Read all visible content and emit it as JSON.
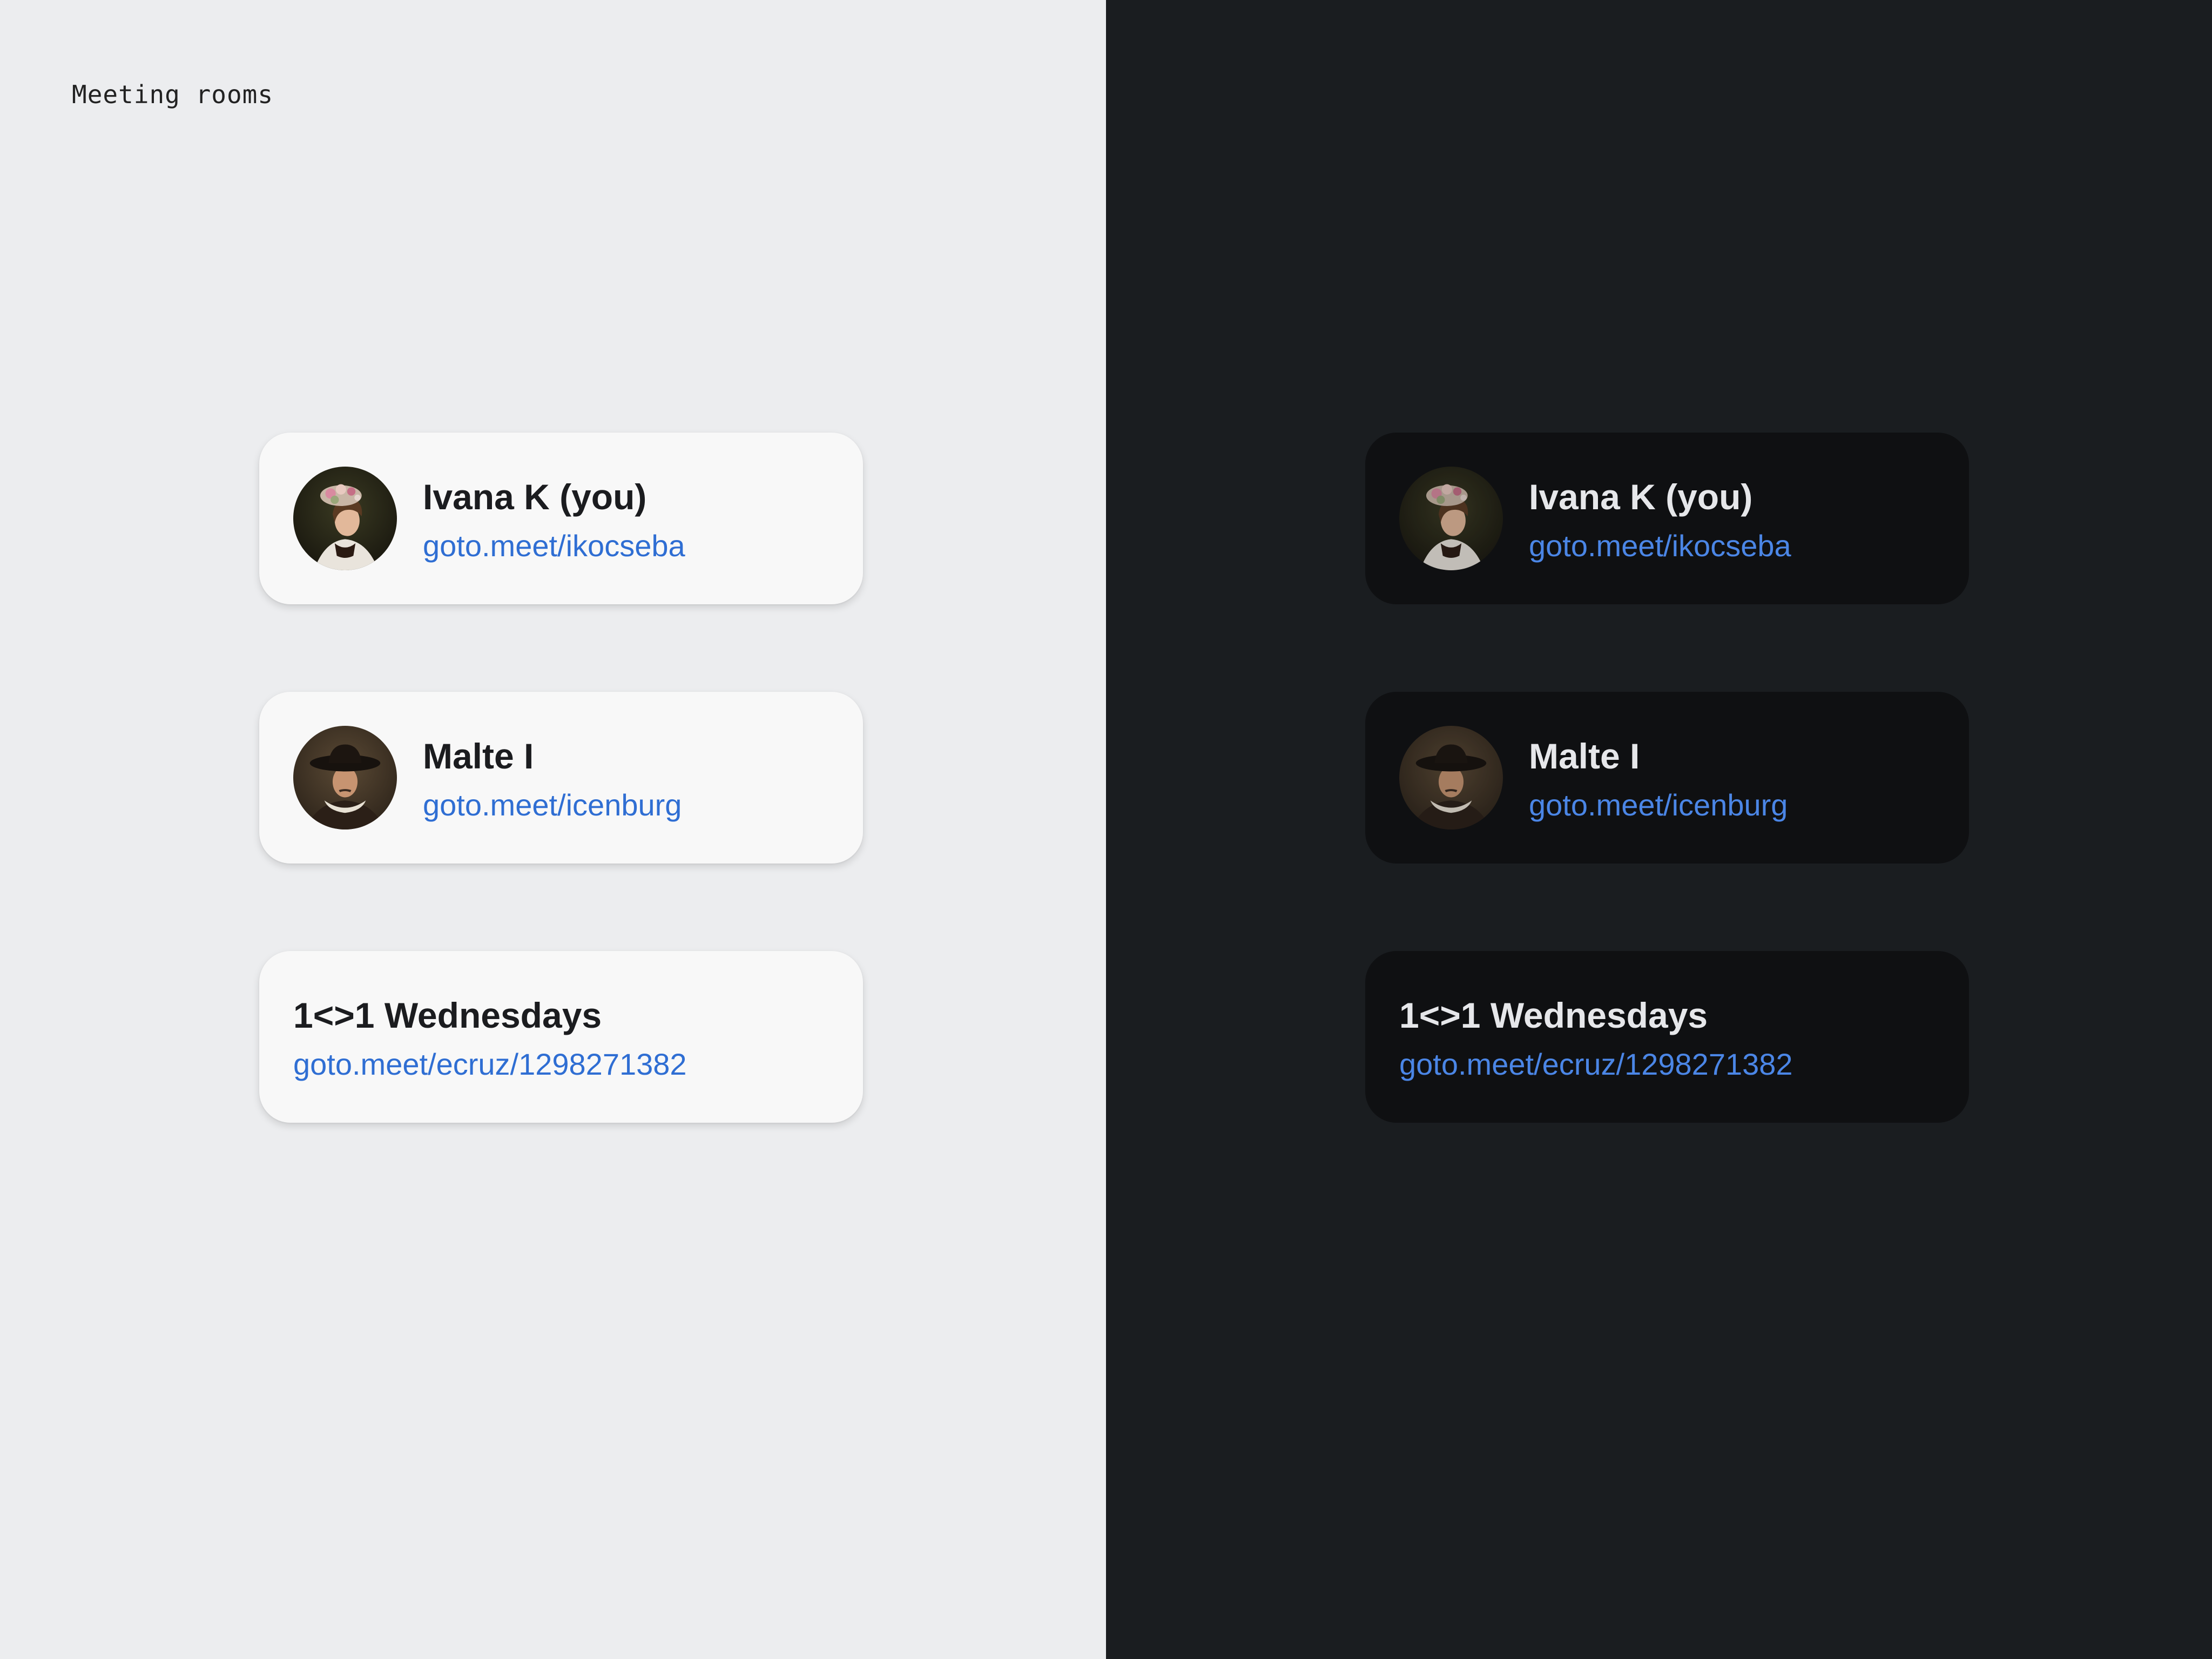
{
  "page": {
    "label": "Meeting rooms"
  },
  "rooms": [
    {
      "title": "Ivana K (you)",
      "link": "goto.meet/ikocseba",
      "avatar_icon": "portrait-woman-with-floral-hat"
    },
    {
      "title": "Malte I",
      "link": "goto.meet/icenburg",
      "avatar_icon": "portrait-man-with-wide-hat"
    },
    {
      "title": "1<>1 Wednesdays",
      "link": "goto.meet/ecruz/1298271382"
    }
  ],
  "colors": {
    "light_background": "#ecedef",
    "dark_background": "#1a1d20",
    "light_card": "#f8f8f8",
    "dark_card": "#0f1012",
    "link_light": "#2f6ed3",
    "link_dark": "#4b86e6"
  }
}
